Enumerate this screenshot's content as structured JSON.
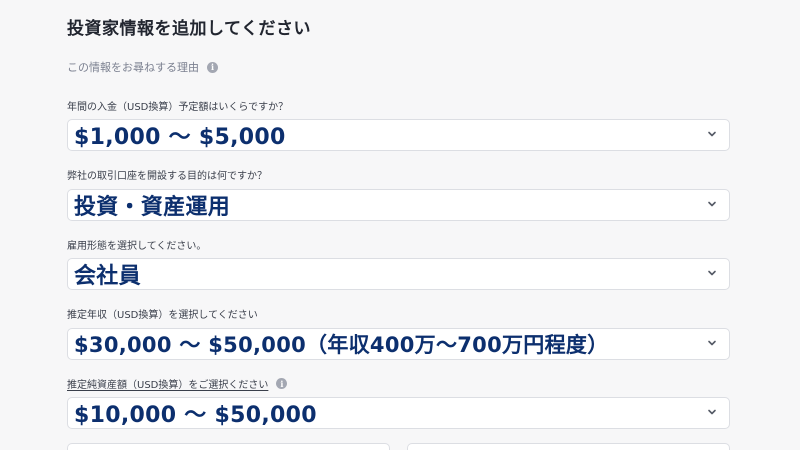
{
  "header": {
    "title": "投資家情報を追加してください",
    "why_text": "この情報をお尋ねする理由",
    "why_icon": "info-icon"
  },
  "questions": [
    {
      "label": "年間の入金（USD換算）予定額はいくらですか？",
      "value": "$1,000 〜 $5,000"
    },
    {
      "label": "弊社の取引口座を開設する目的は何ですか？",
      "value": "投資・資産運用"
    },
    {
      "label": "雇用形態を選択してください。",
      "value": "会社員"
    },
    {
      "label": "推定年収（USD換算）を選択してください",
      "value": "$30,000 〜 $50,000（年収400万〜700万円程度）"
    },
    {
      "label": "推定純資産額（USD換算）をご選択ください",
      "value": "$10,000 〜 $50,000",
      "has_info_icon": true
    }
  ],
  "icons": {
    "dropdown": "chevron-down-icon",
    "info": "info-icon"
  },
  "colors": {
    "background": "#f7f7f8",
    "value_text": "#0c2f6e",
    "field_border": "#dcdee3",
    "info_icon": "#a3a7b2"
  }
}
